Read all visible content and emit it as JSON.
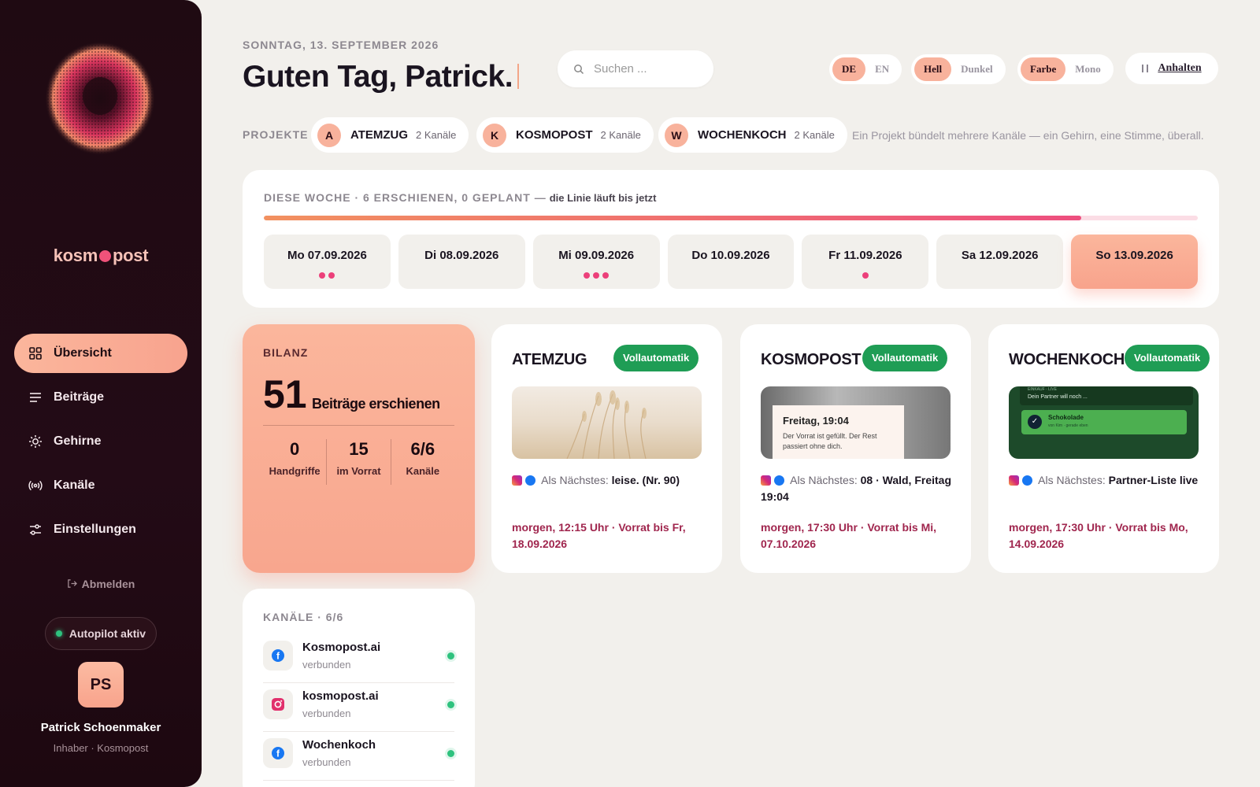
{
  "sidebar": {
    "logo_left": "kosm",
    "logo_right": "post",
    "nav": [
      {
        "label": "Übersicht",
        "icon": "grid-icon",
        "active": true
      },
      {
        "label": "Beiträge",
        "icon": "list-icon",
        "active": false
      },
      {
        "label": "Gehirne",
        "icon": "sun-icon",
        "active": false
      },
      {
        "label": "Kanäle",
        "icon": "broadcast-icon",
        "active": false
      },
      {
        "label": "Einstellungen",
        "icon": "sliders-icon",
        "active": false
      }
    ],
    "logout": "Abmelden",
    "autopilot": "Autopilot aktiv",
    "avatar_initials": "PS",
    "user_name": "Patrick Schoenmaker",
    "user_role": "Inhaber · Kosmopost"
  },
  "header": {
    "date": "SONNTAG, 13. SEPTEMBER 2026",
    "greeting": "Guten Tag, Patrick.",
    "search_placeholder": "Suchen ...",
    "lang": {
      "a": "DE",
      "b": "EN"
    },
    "theme": {
      "a": "Hell",
      "b": "Dunkel"
    },
    "color": {
      "a": "Farbe",
      "b": "Mono"
    },
    "pause": "Anhalten"
  },
  "projects": {
    "label": "PROJEKTE",
    "items": [
      {
        "initial": "A",
        "name": "ATEMZUG",
        "count": "2 Kanäle"
      },
      {
        "initial": "K",
        "name": "KOSMOPOST",
        "count": "2 Kanäle"
      },
      {
        "initial": "W",
        "name": "WOCHENKOCH",
        "count": "2 Kanäle"
      }
    ],
    "note": "Ein Projekt bündelt mehrere Kanäle — ein Gehirn, eine Stimme, überall."
  },
  "week": {
    "title": "DIESE WOCHE · 6 ERSCHIENEN, 0 GEPLANT —",
    "subtitle": "die Linie läuft bis jetzt",
    "progress": 0.875,
    "days": [
      {
        "label": "Mo 07.09.2026",
        "dots": 2
      },
      {
        "label": "Di 08.09.2026",
        "dots": 0
      },
      {
        "label": "Mi 09.09.2026",
        "dots": 3
      },
      {
        "label": "Do 10.09.2026",
        "dots": 0
      },
      {
        "label": "Fr 11.09.2026",
        "dots": 1
      },
      {
        "label": "Sa 12.09.2026",
        "dots": 0
      },
      {
        "label": "So 13.09.2026",
        "dots": 0,
        "today": true
      }
    ]
  },
  "bilanz": {
    "label": "BILANZ",
    "value": "51",
    "value_text": "Beiträge erschienen",
    "stats": [
      {
        "value": "0",
        "label": "Handgriffe"
      },
      {
        "value": "15",
        "label": "im Vorrat"
      },
      {
        "value": "6/6",
        "label": "Kanäle"
      }
    ]
  },
  "cards": [
    {
      "title": "ATEMZUG",
      "badge": "Vollautomatik",
      "next_label": "Als Nächstes:",
      "next_value": "leise. (Nr. 90)",
      "when": "morgen, 12:15 Uhr · Vorrat bis Fr, 18.09.2026"
    },
    {
      "title": "KOSMOPOST",
      "badge": "Vollautomatik",
      "next_label": "Als Nächstes:",
      "next_value": "08 · Wald, Freitag 19:04",
      "when": "morgen, 17:30 Uhr · Vorrat bis Mi, 07.10.2026",
      "img_title": "Freitag, 19:04",
      "img_text": "Der Vorrat ist gefüllt. Der Rest passiert ohne dich."
    },
    {
      "title": "WOCHENKOCH",
      "badge": "Vollautomatik",
      "next_label": "Als Nächstes:",
      "next_value": "Partner-Liste live",
      "when": "morgen, 17:30 Uhr · Vorrat bis Mo, 14.09.2026",
      "img_top_a": "EINKAUF · LIVE",
      "img_top_b": "Dein Partner will noch ...",
      "img_row_title": "Schokolade",
      "img_row_sub": "von Kim · gerade eben"
    }
  ],
  "channels": {
    "label": "KANÄLE · 6/6",
    "items": [
      {
        "name": "Kosmopost.ai",
        "status": "verbunden",
        "icon": "facebook-icon"
      },
      {
        "name": "kosmopost.ai",
        "status": "verbunden",
        "icon": "instagram-icon"
      },
      {
        "name": "Wochenkoch",
        "status": "verbunden",
        "icon": "facebook-icon"
      }
    ]
  },
  "colors": {
    "accent": "#f8a68e",
    "green": "#1f9d55",
    "dot": "#ec407a",
    "sidebar": "#1f0a12"
  }
}
